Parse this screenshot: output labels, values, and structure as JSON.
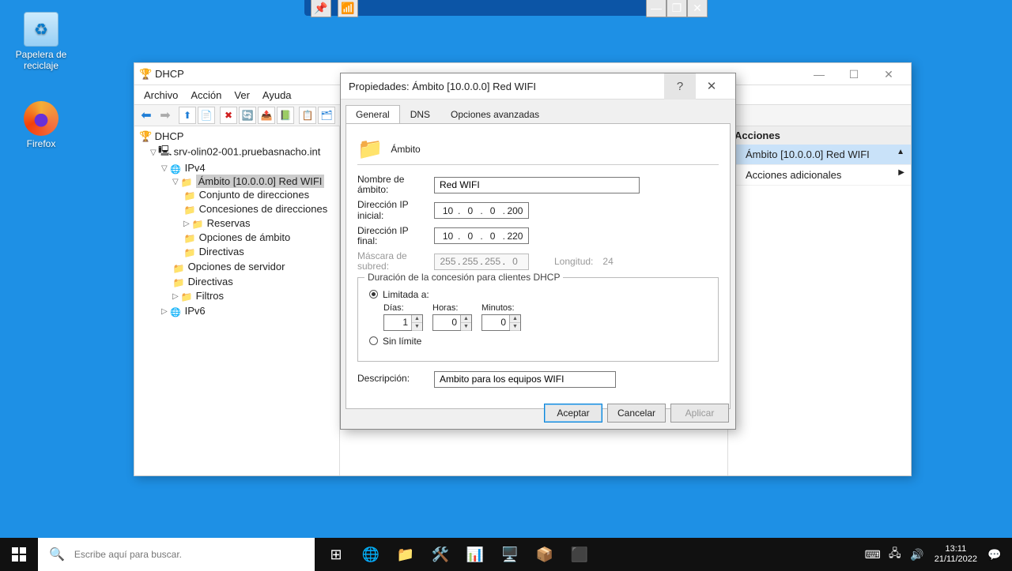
{
  "desktop": {
    "recycle": "Papelera de reciclaje",
    "firefox": "Firefox"
  },
  "connbar": {
    "minimize": "—",
    "restore": "❐",
    "close": "✕",
    "pin": "📌",
    "signal": "📶"
  },
  "mmc": {
    "title": "DHCP",
    "menu": {
      "archivo": "Archivo",
      "accion": "Acción",
      "ver": "Ver",
      "ayuda": "Ayuda"
    },
    "winctl": {
      "min": "—",
      "max": "☐",
      "close": "✕"
    },
    "tree": {
      "root": "DHCP",
      "server": "srv-olin02-001.pruebasnacho.int",
      "ipv4": "IPv4",
      "scope": "Ámbito [10.0.0.0] Red WIFI",
      "items": {
        "pool": "Conjunto de direcciones",
        "leases": "Concesiones de direcciones",
        "reserv": "Reservas",
        "opts_scope": "Opciones de ámbito",
        "policies": "Directivas"
      },
      "srvopts": "Opciones de servidor",
      "policies2": "Directivas",
      "filters": "Filtros",
      "ipv6": "IPv6"
    },
    "actions": {
      "header": "Acciones",
      "scope": "Ámbito [10.0.0.0] Red WIFI",
      "more": "Acciones adicionales"
    }
  },
  "dialog": {
    "title": "Propiedades: Ámbito [10.0.0.0] Red WIFI",
    "help": "?",
    "close": "✕",
    "tabs": {
      "general": "General",
      "dns": "DNS",
      "adv": "Opciones avanzadas"
    },
    "section": "Ámbito",
    "labels": {
      "name": "Nombre de ámbito:",
      "ip_start": "Dirección IP inicial:",
      "ip_end": "Dirección IP final:",
      "mask": "Máscara de subred:",
      "length": "Longitud:",
      "desc": "Descripción:",
      "fieldset": "Duración de la concesión para clientes DHCP",
      "limited": "Limitada a:",
      "unlimited": "Sin límite",
      "days": "Días:",
      "hours": "Horas:",
      "minutes": "Minutos:"
    },
    "values": {
      "name": "Red WIFI",
      "ip_start": {
        "a": "10",
        "b": "0",
        "c": "0",
        "d": "200"
      },
      "ip_end": {
        "a": "10",
        "b": "0",
        "c": "0",
        "d": "220"
      },
      "mask": {
        "a": "255",
        "b": "255",
        "c": "255",
        "d": "0"
      },
      "length": "24",
      "days": "1",
      "hours": "0",
      "minutes": "0",
      "desc": "Ambito para los equipos WIFI"
    },
    "buttons": {
      "ok": "Aceptar",
      "cancel": "Cancelar",
      "apply": "Aplicar"
    }
  },
  "taskbar": {
    "search_placeholder": "Escribe aquí para buscar.",
    "clock_time": "13:11",
    "clock_date": "21/11/2022"
  }
}
